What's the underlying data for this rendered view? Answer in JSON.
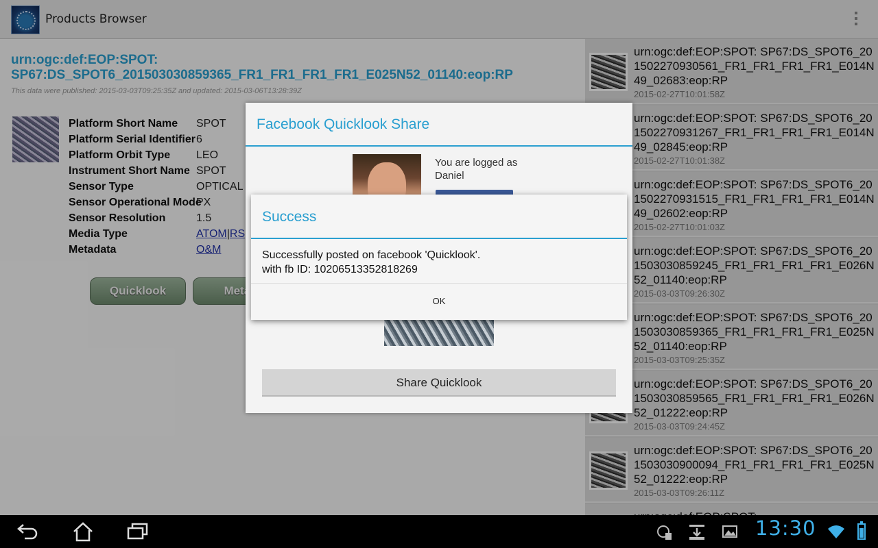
{
  "app": {
    "title": "Products Browser"
  },
  "detail": {
    "urn_line1": "urn:ogc:def:EOP:SPOT:",
    "urn_line2": "SP67:DS_SPOT6_201503030859365_FR1_FR1_FR1_FR1_E025N52_01140:eop:RP",
    "published": "This data were published: 2015-03-03T09:25:35Z and updated: 2015-03-06T13:28:39Z",
    "metadata": [
      {
        "key": "Platform Short Name",
        "value": "SPOT"
      },
      {
        "key": "Platform Serial Identifier",
        "value": "6"
      },
      {
        "key": "Platform Orbit Type",
        "value": "LEO"
      },
      {
        "key": "Instrument Short Name",
        "value": "SPOT"
      },
      {
        "key": "Sensor Type",
        "value": "OPTICAL"
      },
      {
        "key": "Sensor Operational Mode",
        "value": "PX"
      },
      {
        "key": "Sensor Resolution",
        "value": "1.5"
      },
      {
        "key": "Media Type",
        "value": ""
      },
      {
        "key": "Metadata",
        "value": ""
      }
    ],
    "media_links": {
      "atom": "ATOM",
      "sep": "|",
      "rss": "RS"
    },
    "metadata_link": "O&M",
    "buttons": {
      "quicklook": "Quicklook",
      "metadata": "Metad"
    }
  },
  "list": [
    {
      "urn": "urn:ogc:def:EOP:SPOT: SP67:DS_SPOT6_201502270930561_FR1_FR1_FR1_FR1_E014N49_02683:eop:RP",
      "date": "2015-02-27T10:01:58Z"
    },
    {
      "urn": "urn:ogc:def:EOP:SPOT: SP67:DS_SPOT6_201502270931267_FR1_FR1_FR1_FR1_E014N49_02845:eop:RP",
      "date": "2015-02-27T10:01:38Z"
    },
    {
      "urn": "urn:ogc:def:EOP:SPOT: SP67:DS_SPOT6_201502270931515_FR1_FR1_FR1_FR1_E014N49_02602:eop:RP",
      "date": "2015-02-27T10:01:03Z"
    },
    {
      "urn": "urn:ogc:def:EOP:SPOT: SP67:DS_SPOT6_201503030859245_FR1_FR1_FR1_FR1_E026N52_01140:eop:RP",
      "date": "2015-03-03T09:26:30Z"
    },
    {
      "urn": "urn:ogc:def:EOP:SPOT: SP67:DS_SPOT6_201503030859365_FR1_FR1_FR1_FR1_E025N52_01140:eop:RP",
      "date": "2015-03-03T09:25:35Z"
    },
    {
      "urn": "urn:ogc:def:EOP:SPOT: SP67:DS_SPOT6_201503030859565_FR1_FR1_FR1_FR1_E026N52_01222:eop:RP",
      "date": "2015-03-03T09:24:45Z"
    },
    {
      "urn": "urn:ogc:def:EOP:SPOT: SP67:DS_SPOT6_201503030900094_FR1_FR1_FR1_FR1_E025N52_01222:eop:RP",
      "date": "2015-03-03T09:26:11Z"
    },
    {
      "urn": "urn:ogc:def:EOP:SPOT:",
      "date": ""
    }
  ],
  "fb_dialog": {
    "title": "Facebook Quicklook Share",
    "logged_line1": "You are logged as",
    "logged_line2": "Daniel",
    "share_button": "Share Quicklook"
  },
  "success_dialog": {
    "title": "Success",
    "message_line1": "Successfully posted on facebook 'Quicklook'.",
    "message_line2": "with fb ID: 10206513352818269",
    "ok_button": "OK"
  },
  "statusbar": {
    "time": "13:30"
  },
  "colors": {
    "accent": "#2a9fd0",
    "clock": "#3fb0e8",
    "facebook": "#3b5998"
  }
}
